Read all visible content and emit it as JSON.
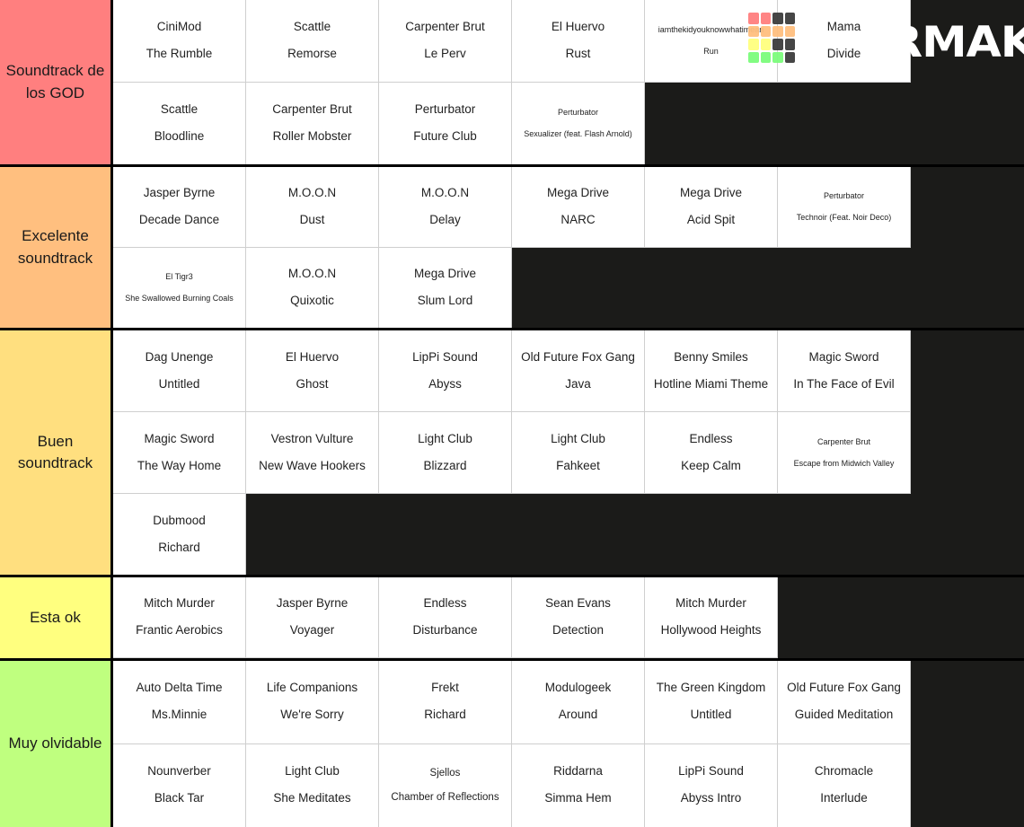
{
  "app": {
    "watermark_text": "TIERMAKER",
    "watermark_logo_name": "tiermaker-logo"
  },
  "colors": {
    "tier1": "#FF7F7F",
    "tier2": "#FFBF7F",
    "tier3": "#FFDF7F",
    "tier4": "#FFFF7F",
    "tier5": "#BFFF7F",
    "background": "#1b1b19",
    "cell_background": "#ffffff",
    "cell_border": "#cfcfcf",
    "row_divider": "#000000",
    "text": "#222222"
  },
  "tiers": [
    {
      "label": "Soundtrack de los GOD",
      "color": "#FF7F7F",
      "rows": 2,
      "items": [
        {
          "artist": "CiniMod",
          "track": "The Rumble"
        },
        {
          "artist": "Scattle",
          "track": "Remorse"
        },
        {
          "artist": "Carpenter Brut",
          "track": "Le Perv"
        },
        {
          "artist": "El Huervo",
          "track": "Rust"
        },
        {
          "artist": "iamthekidyouknowwhatimean",
          "track": "Run"
        },
        {
          "artist": "Mama",
          "track": "Divide"
        },
        {
          "artist": "Scattle",
          "track": "Bloodline"
        },
        {
          "artist": "Carpenter Brut",
          "track": "Roller Mobster"
        },
        {
          "artist": "Perturbator",
          "track": "Future Club"
        },
        {
          "artist": "Perturbator",
          "track": "Sexualizer (feat. Flash Arnold)"
        }
      ]
    },
    {
      "label": "Excelente soundtrack",
      "color": "#FFBF7F",
      "rows": 2,
      "items": [
        {
          "artist": "Jasper Byrne",
          "track": "Decade Dance"
        },
        {
          "artist": "M.O.O.N",
          "track": "Dust"
        },
        {
          "artist": "M.O.O.N",
          "track": "Delay"
        },
        {
          "artist": "Mega Drive",
          "track": "NARC"
        },
        {
          "artist": "Mega Drive",
          "track": "Acid Spit"
        },
        {
          "artist": "Perturbator",
          "track": "Technoir (Feat. Noir Deco)"
        },
        {
          "artist": "El Tigr3",
          "track": "She Swallowed Burning Coals"
        },
        {
          "artist": "M.O.O.N",
          "track": "Quixotic"
        },
        {
          "artist": "Mega Drive",
          "track": "Slum Lord"
        }
      ]
    },
    {
      "label": "Buen soundtrack",
      "color": "#FFDF7F",
      "rows": 3,
      "items": [
        {
          "artist": "Dag Unenge",
          "track": "Untitled"
        },
        {
          "artist": "El Huervo",
          "track": "Ghost"
        },
        {
          "artist": "LipPi Sound",
          "track": "Abyss"
        },
        {
          "artist": "Old Future Fox Gang",
          "track": "Java"
        },
        {
          "artist": "Benny Smiles",
          "track": "Hotline Miami Theme"
        },
        {
          "artist": "Magic Sword",
          "track": "In The Face of Evil"
        },
        {
          "artist": "Magic Sword",
          "track": "The Way Home"
        },
        {
          "artist": "Vestron Vulture",
          "track": "New Wave Hookers"
        },
        {
          "artist": "Light Club",
          "track": "Blizzard"
        },
        {
          "artist": "Light Club",
          "track": "Fahkeet"
        },
        {
          "artist": "Endless",
          "track": "Keep Calm"
        },
        {
          "artist": "Carpenter Brut",
          "track": "Escape from Midwich Valley"
        },
        {
          "artist": "Dubmood",
          "track": "Richard"
        }
      ]
    },
    {
      "label": "Esta ok",
      "color": "#FFFF7F",
      "rows": 1,
      "items": [
        {
          "artist": "Mitch Murder",
          "track": "Frantic Aerobics"
        },
        {
          "artist": "Jasper Byrne",
          "track": "Voyager"
        },
        {
          "artist": "Endless",
          "track": "Disturbance"
        },
        {
          "artist": "Sean Evans",
          "track": "Detection"
        },
        {
          "artist": "Mitch Murder",
          "track": "Hollywood Heights"
        }
      ]
    },
    {
      "label": "Muy olvidable",
      "color": "#BFFF7F",
      "rows": 2,
      "items": [
        {
          "artist": "Auto Delta Time",
          "track": "Ms.Minnie"
        },
        {
          "artist": "Life Companions",
          "track": "We're Sorry"
        },
        {
          "artist": "Frekt",
          "track": "Richard"
        },
        {
          "artist": "Modulogeek",
          "track": "Around"
        },
        {
          "artist": "The Green Kingdom",
          "track": "Untitled"
        },
        {
          "artist": "Old Future Fox Gang",
          "track": "Guided Meditation"
        },
        {
          "artist": "Nounverber",
          "track": "Black Tar"
        },
        {
          "artist": "Light Club",
          "track": "She Meditates"
        },
        {
          "artist": "Sjellos",
          "track": "Chamber of Reflections"
        },
        {
          "artist": "Riddarna",
          "track": "Simma Hem"
        },
        {
          "artist": "LipPi Sound",
          "track": "Abyss Intro"
        },
        {
          "artist": "Chromacle",
          "track": "Interlude"
        }
      ]
    }
  ]
}
